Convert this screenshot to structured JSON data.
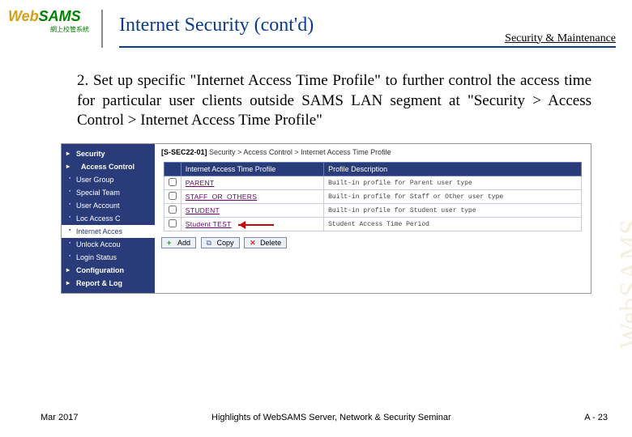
{
  "logo": {
    "part1": "Web",
    "part2": "SAMS",
    "sub": "網上校管系統"
  },
  "slide_title": "Internet Security (cont'd)",
  "breadcrumb_top": "Security & Maintenance",
  "body": "2. Set up specific \"Internet Access Time Profile\" to further control the access time for particular user clients outside SAMS LAN segment at \"Security > Access Control > Internet Access Time Profile\"",
  "sidebar": {
    "root": "Security",
    "group": "Access Control",
    "items": [
      "User Group",
      "Special Team",
      "User Account",
      "Loc Access C",
      "Internet Acces",
      "Unlock Accou",
      "Login Status"
    ],
    "selected_index": 4,
    "tail": [
      "Configuration",
      "Report & Log"
    ]
  },
  "crumb": {
    "code": "[S-SEC22-01]",
    "path": "Security > Access Control > Internet Access Time Profile"
  },
  "table": {
    "headers": [
      "",
      "Internet Access Time Profile",
      "Profile Description"
    ],
    "rows": [
      {
        "name": "PARENT",
        "desc": "Built-in profile for Parent user type",
        "arrow": false
      },
      {
        "name": "STAFF_OR_OTHERS",
        "desc": "Built-in profile for Staff or Other user type",
        "arrow": false
      },
      {
        "name": "STUDENT",
        "desc": "Built-in profile for Student user type",
        "arrow": false
      },
      {
        "name": "Student TEST",
        "desc": "Student Access Time Period",
        "arrow": true
      }
    ]
  },
  "buttons": {
    "add": "Add",
    "copy": "Copy",
    "delete": "Delete"
  },
  "footer": {
    "left": "Mar 2017",
    "center": "Highlights of WebSAMS Server, Network & Security Seminar",
    "right": "A - 23"
  },
  "watermark": "WebSAMS"
}
